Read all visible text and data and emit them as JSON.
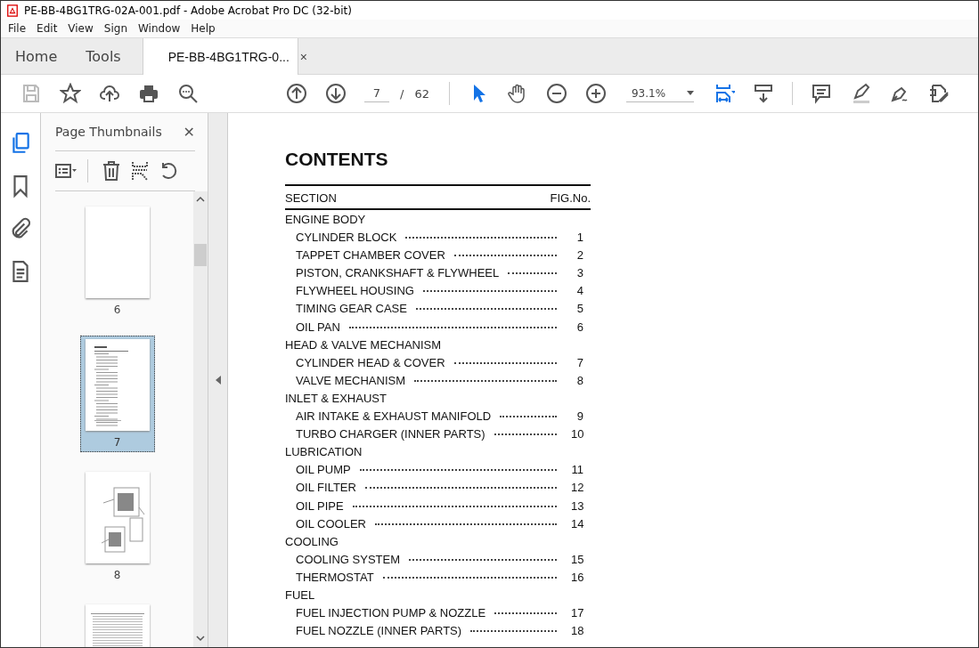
{
  "window": {
    "title": "PE-BB-4BG1TRG-02A-001.pdf - Adobe Acrobat Pro DC (32-bit)"
  },
  "menu": [
    "File",
    "Edit",
    "View",
    "Sign",
    "Window",
    "Help"
  ],
  "tabs": [
    {
      "label": "Home",
      "kind": "nav",
      "selected": false
    },
    {
      "label": "Tools",
      "kind": "nav",
      "selected": false
    },
    {
      "label": "PE-BB-4BG1TRG-0...",
      "kind": "document",
      "selected": true,
      "close": "×"
    }
  ],
  "toolbar": {
    "page_current": "7",
    "page_separator": "/",
    "page_total": "62",
    "zoom": "93.1%"
  },
  "rail": [
    {
      "kind": "pages",
      "selected": true
    },
    {
      "kind": "bookmark",
      "selected": false
    },
    {
      "kind": "attachment",
      "selected": false
    },
    {
      "kind": "document",
      "selected": false
    }
  ],
  "panel": {
    "title": "Page Thumbnails",
    "close": "✕",
    "thumbnails": [
      {
        "kind": "blank",
        "label": "6",
        "selected": false
      },
      {
        "kind": "contents",
        "label": "7",
        "selected": true
      },
      {
        "kind": "diagram",
        "label": "8",
        "selected": false
      },
      {
        "kind": "table",
        "selected": false
      }
    ]
  },
  "document": {
    "title": "CONTENTS",
    "header_section": "SECTION",
    "header_fig": "FIG.No.",
    "entries": [
      {
        "kind": "heading",
        "text": "ENGINE BODY"
      },
      {
        "kind": "item",
        "text": "CYLINDER BLOCK",
        "fig": "1"
      },
      {
        "kind": "item",
        "text": "TAPPET CHAMBER COVER",
        "fig": "2"
      },
      {
        "kind": "item",
        "text": "PISTON, CRANKSHAFT & FLYWHEEL",
        "fig": "3"
      },
      {
        "kind": "item",
        "text": "FLYWHEEL HOUSING",
        "fig": "4"
      },
      {
        "kind": "item",
        "text": "TIMING GEAR CASE",
        "fig": "5"
      },
      {
        "kind": "item",
        "text": "OIL PAN",
        "fig": "6"
      },
      {
        "kind": "heading",
        "text": "HEAD & VALVE MECHANISM"
      },
      {
        "kind": "item",
        "text": "CYLINDER HEAD & COVER",
        "fig": "7"
      },
      {
        "kind": "item",
        "text": "VALVE MECHANISM",
        "fig": "8"
      },
      {
        "kind": "heading",
        "text": "INLET & EXHAUST"
      },
      {
        "kind": "item",
        "text": "AIR INTAKE & EXHAUST MANIFOLD",
        "fig": "9"
      },
      {
        "kind": "item",
        "text": "TURBO CHARGER (INNER PARTS)",
        "fig": "10"
      },
      {
        "kind": "heading",
        "text": "LUBRICATION"
      },
      {
        "kind": "item",
        "text": "OIL PUMP",
        "fig": "11"
      },
      {
        "kind": "item",
        "text": "OIL FILTER",
        "fig": "12"
      },
      {
        "kind": "item",
        "text": "OIL PIPE",
        "fig": "13"
      },
      {
        "kind": "item",
        "text": "OIL COOLER",
        "fig": "14"
      },
      {
        "kind": "heading",
        "text": "COOLING"
      },
      {
        "kind": "item",
        "text": "COOLING SYSTEM",
        "fig": "15"
      },
      {
        "kind": "item",
        "text": "THERMOSTAT",
        "fig": "16"
      },
      {
        "kind": "heading",
        "text": "FUEL"
      },
      {
        "kind": "item",
        "text": "FUEL INJECTION PUMP & NOZZLE",
        "fig": "17"
      },
      {
        "kind": "item",
        "text": "FUEL NOZZLE (INNER PARTS)",
        "fig": "18"
      }
    ]
  }
}
